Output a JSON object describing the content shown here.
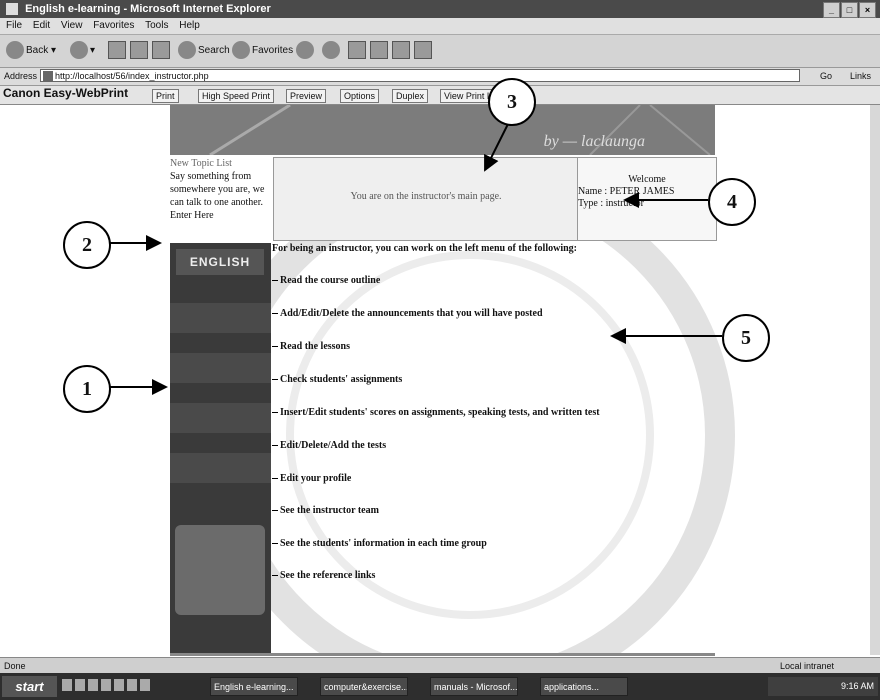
{
  "window": {
    "title": "English e-learning - Microsoft Internet Explorer",
    "controls": [
      "_",
      "□",
      "×"
    ]
  },
  "menu": [
    "File",
    "Edit",
    "View",
    "Favorites",
    "Tools",
    "Help"
  ],
  "toolbar": {
    "back": "Back",
    "search": "Search",
    "favorites": "Favorites"
  },
  "address": {
    "label": "Address",
    "url": "http://localhost/56/index_instructor.php",
    "go": "Go",
    "links": "Links"
  },
  "canon": {
    "brand": "Canon Easy-WebPrint",
    "buttons": [
      "Print",
      "High Speed Print",
      "Preview",
      "Options",
      "Duplex",
      "View Print List"
    ]
  },
  "page": {
    "banner_text": "by — laclaunga",
    "topic": {
      "heading": "New Topic List",
      "text": "Say something from somewhere you are, we can talk to one another.",
      "more": "Enter Here"
    },
    "welcome_message": "You are on the instructor's main page.",
    "user": {
      "welcome": "Welcome",
      "name": "Name : PETER JAMES",
      "type": "Type : instructor"
    },
    "sidebar_logo": "ENGLISH",
    "intro": "For being an instructor, you can work on the left menu of the following:",
    "menu_items": [
      "Read the course outline",
      "Add/Edit/Delete the announcements that you will have posted",
      "Read the lessons",
      "Check students' assignments",
      "Insert/Edit students' scores on assignments, speaking tests, and written test",
      "Edit/Delete/Add the tests",
      "Edit your profile",
      "See the instructor team",
      "See the students' information in each time group",
      "See the reference links"
    ]
  },
  "callouts": [
    "1",
    "2",
    "3",
    "4",
    "5"
  ],
  "status": {
    "left": "Done",
    "zone": "Local intranet"
  },
  "taskbar": {
    "start": "start",
    "tasks": [
      "English e-learning...",
      "computer&exercise...",
      "manuals - Microsof...",
      "applications..."
    ],
    "clock": "9:16 AM"
  }
}
